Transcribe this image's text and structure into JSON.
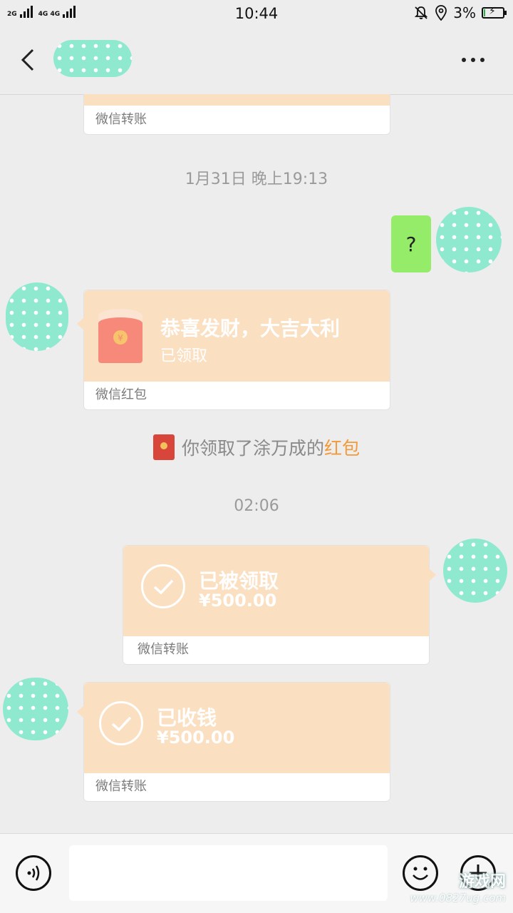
{
  "status_bar": {
    "network_left": "2G",
    "network_right": "4G 4G",
    "time": "10:44",
    "battery": "3%",
    "mute_icon": "bell-off-icon",
    "location_icon": "location-pin-icon",
    "battery_icon": "battery-charging-icon"
  },
  "nav": {
    "back_icon": "back-chevron-icon",
    "more_icon": "more-dots-icon"
  },
  "messages": {
    "top_transfer_footer": "微信转账",
    "ts1": "1月31日 晚上19:13",
    "question_text": "?",
    "red_packet": {
      "title": "恭喜发财，大吉大利",
      "status": "已领取",
      "footer": "微信红包"
    },
    "system_notice": {
      "prefix": "你领取了涂万成的",
      "link": "红包"
    },
    "ts2": "02:06",
    "transfer_sent": {
      "title": "已被领取",
      "amount": "¥500.00",
      "footer": "微信转账"
    },
    "transfer_received": {
      "title": "已收钱",
      "amount": "¥500.00",
      "footer": "微信转账"
    }
  },
  "input_bar": {
    "voice_icon": "voice-icon",
    "emoji_icon": "emoji-icon",
    "plus_icon": "plus-icon"
  },
  "watermark": {
    "text": "游戏网",
    "url": "www.0827ug.com"
  },
  "colors": {
    "background": "#ededed",
    "card_orange": "#fbdfc1",
    "bubble_green": "#95ec69",
    "link_orange": "#f29a38"
  }
}
